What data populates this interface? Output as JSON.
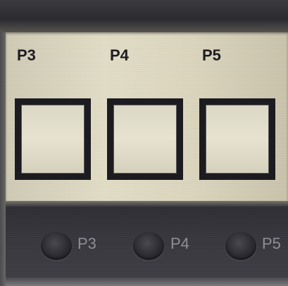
{
  "panel": {
    "buttons": [
      {
        "label": "P3"
      },
      {
        "label": "P4"
      },
      {
        "label": "P5"
      }
    ],
    "indicators": [
      {
        "label": "P3"
      },
      {
        "label": "P4"
      },
      {
        "label": "P5"
      }
    ]
  }
}
